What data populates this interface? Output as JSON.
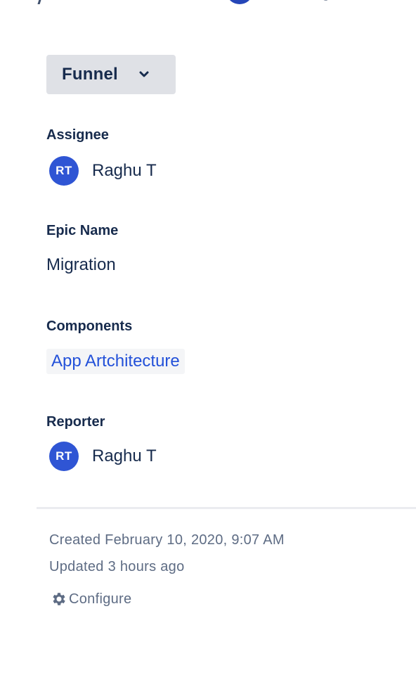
{
  "status": {
    "label": "Funnel",
    "chevron_icon": "chevron-down-icon"
  },
  "fields": {
    "assignee": {
      "label": "Assignee",
      "avatar_initials": "RT",
      "name": "Raghu T"
    },
    "epic_name": {
      "label": "Epic Name",
      "value": "Migration"
    },
    "components": {
      "label": "Components",
      "items": [
        "App Artchitecture"
      ]
    },
    "reporter": {
      "label": "Reporter",
      "avatar_initials": "RT",
      "name": "Raghu T"
    }
  },
  "meta": {
    "created": "Created February 10, 2020, 9:07 AM",
    "updated": "Updated 3 hours ago",
    "configure_label": "Configure",
    "configure_icon": "gear-icon"
  },
  "colors": {
    "avatar": "#2f55d4",
    "link": "#2351d9",
    "status_bg": "#dfe1e6",
    "text": "#172b4d",
    "subtle_text": "#5e6c84"
  }
}
